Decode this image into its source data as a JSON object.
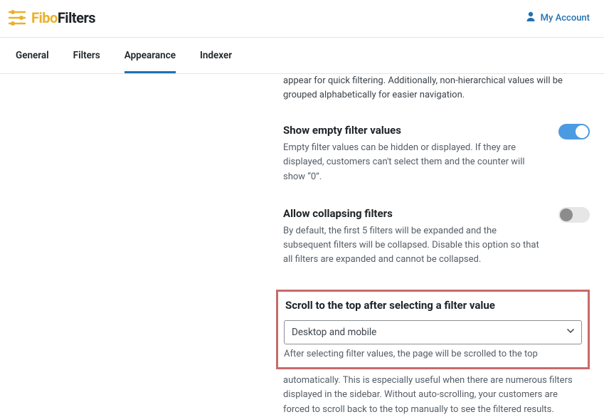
{
  "header": {
    "logo_fibo": "Fibo",
    "logo_filters": "Filters",
    "account_label": "My Account"
  },
  "tabs": {
    "general": "General",
    "filters": "Filters",
    "appearance": "Appearance",
    "indexer": "Indexer"
  },
  "partial_top": "appear for quick filtering. Additionally, non-hierarchical values will be grouped alphabetically for easier navigation.",
  "sections": {
    "show_empty": {
      "title": "Show empty filter values",
      "desc": "Empty filter values can be hidden or displayed. If they are displayed, customers can't select them and the counter will show “0”.",
      "on": true
    },
    "allow_collapse": {
      "title": "Allow collapsing filters",
      "desc": "By default, the first 5 filters will be expanded and the subsequent filters will be collapsed. Disable this option so that all filters are expanded and cannot be collapsed.",
      "on": false
    },
    "scroll_top": {
      "title": "Scroll to the top after selecting a filter value",
      "select_value": "Desktop and mobile",
      "desc_in": "After selecting filter values, the page will be scrolled to the top",
      "desc_after": "automatically. This is especially useful when there are numerous filters displayed in the sidebar. Without auto-scrolling, your customers are forced to scroll back to the top manually to see the filtered results."
    }
  }
}
